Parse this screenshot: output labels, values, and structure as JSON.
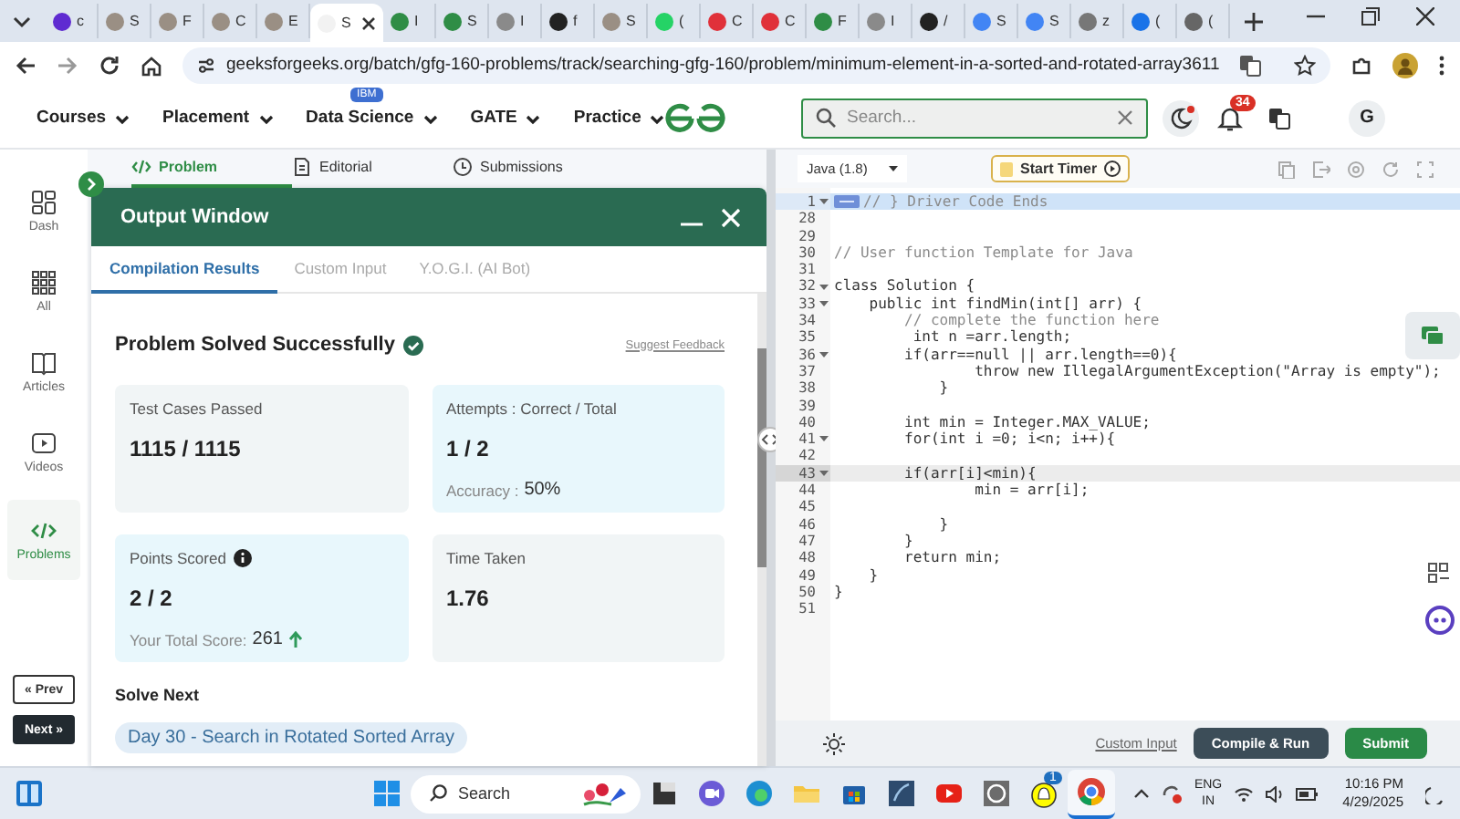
{
  "browser": {
    "tabs": [
      {
        "title": "c",
        "color": "#5f2bd1",
        "selected": false
      },
      {
        "title": "S",
        "color": "#9a8f84",
        "selected": false
      },
      {
        "title": "F",
        "color": "#9a8f84",
        "selected": false
      },
      {
        "title": "C",
        "color": "#9a8f84",
        "selected": false
      },
      {
        "title": "E",
        "color": "#9a8f84",
        "selected": false
      },
      {
        "title": "S",
        "color": "#f2f2f2",
        "selected": true
      },
      {
        "title": "I",
        "color": "#2f8d46",
        "selected": false
      },
      {
        "title": "S",
        "color": "#2f8d46",
        "selected": false
      },
      {
        "title": "I",
        "color": "#8a8a8a",
        "selected": false
      },
      {
        "title": "f",
        "color": "#222222",
        "selected": false
      },
      {
        "title": "S",
        "color": "#9a8f84",
        "selected": false
      },
      {
        "title": "(",
        "color": "#25d366",
        "selected": false
      },
      {
        "title": "C",
        "color": "#e0313a",
        "selected": false
      },
      {
        "title": "C",
        "color": "#e0313a",
        "selected": false
      },
      {
        "title": "F",
        "color": "#2f8d46",
        "selected": false
      },
      {
        "title": "I",
        "color": "#8a8a8a",
        "selected": false
      },
      {
        "title": "/",
        "color": "#222222",
        "selected": false
      },
      {
        "title": "S",
        "color": "#4285f4",
        "selected": false
      },
      {
        "title": "S",
        "color": "#4285f4",
        "selected": false
      },
      {
        "title": "z",
        "color": "#777777",
        "selected": false
      },
      {
        "title": "(",
        "color": "#1a73e8",
        "selected": false
      },
      {
        "title": "(",
        "color": "#666666",
        "selected": false
      }
    ],
    "url": "geeksforgeeks.org/batch/gfg-160-problems/track/searching-gfg-160/problem/minimum-element-in-a-sorted-and-rotated-array3611"
  },
  "site_nav": {
    "menus": [
      {
        "label": "Courses"
      },
      {
        "label": "Placement"
      },
      {
        "label": "Data Science",
        "badge": "IBM"
      },
      {
        "label": "GATE"
      },
      {
        "label": "Practice"
      }
    ],
    "search": {
      "placeholder": "Search..."
    },
    "notifications": "34",
    "avatar": "G"
  },
  "sidebar": {
    "items": [
      {
        "label": "Dash",
        "selected": false
      },
      {
        "label": "All",
        "selected": false
      },
      {
        "label": "Articles",
        "selected": false
      },
      {
        "label": "Videos",
        "selected": false
      },
      {
        "label": "Problems",
        "selected": true
      }
    ],
    "prev": "« Prev",
    "next": "Next »"
  },
  "problem_tabs": [
    {
      "label": "Problem",
      "selected": true
    },
    {
      "label": "Editorial",
      "selected": false
    },
    {
      "label": "Submissions",
      "selected": false
    }
  ],
  "output_window": {
    "title": "Output Window",
    "tabs": [
      {
        "label": "Compilation Results",
        "selected": true
      },
      {
        "label": "Custom Input",
        "selected": false
      },
      {
        "label": "Y.O.G.I. (AI Bot)",
        "selected": false
      }
    ],
    "status": "Problem Solved Successfully",
    "feedback_link": "Suggest Feedback",
    "cards": [
      {
        "label": "Test Cases Passed",
        "value": "1115 / 1115",
        "color": "#f1f5f6",
        "info": false
      },
      {
        "label": "Attempts : Correct / Total",
        "value": "1 / 2",
        "color": "#e8f7fc",
        "info": false,
        "footer": {
          "label": "Accuracy : ",
          "value": "50%"
        }
      },
      {
        "label": "Points Scored",
        "value": "2 / 2",
        "color": "#e8f7fc",
        "info": true,
        "footer": {
          "label": "Your Total Score: ",
          "value": "261",
          "rising": true
        }
      },
      {
        "label": "Time Taken",
        "value": "1.76",
        "color": "#f1f5f6",
        "info": false
      }
    ],
    "solve_next": {
      "heading": "Solve Next",
      "items": [
        "Day 30 - Search in Rotated Sorted Array"
      ]
    }
  },
  "editor": {
    "language": "Java (1.8)",
    "timer_button": "Start Timer",
    "lines": [
      {
        "number": "1",
        "kind": "folded",
        "text": "// } Driver Code Ends",
        "fold": true,
        "selected": true,
        "current": false
      },
      {
        "number": "28",
        "kind": "blank",
        "fold": false,
        "selected": false,
        "current": false
      },
      {
        "number": "29",
        "kind": "blank",
        "fold": false,
        "selected": false,
        "current": false
      },
      {
        "number": "30",
        "kind": "comment",
        "text": "// User function Template for Java",
        "fold": false,
        "selected": false,
        "current": false
      },
      {
        "number": "31",
        "kind": "blank",
        "fold": false,
        "selected": false,
        "current": false
      },
      {
        "number": "32",
        "kind": "code",
        "text": "class Solution {",
        "fold": true,
        "selected": false,
        "current": false
      },
      {
        "number": "33",
        "kind": "code",
        "text": "    public int findMin(int[] arr) {",
        "fold": true,
        "selected": false,
        "current": false
      },
      {
        "number": "34",
        "kind": "comment",
        "text": "        // complete the function here",
        "fold": false,
        "selected": false,
        "current": false
      },
      {
        "number": "35",
        "kind": "code",
        "text": "         int n =arr.length;",
        "fold": false,
        "selected": false,
        "current": false
      },
      {
        "number": "36",
        "kind": "code",
        "text": "        if(arr==null || arr.length==0){",
        "fold": true,
        "selected": false,
        "current": false
      },
      {
        "number": "37",
        "kind": "code",
        "text": "                throw new IllegalArgumentException(\"Array is empty\");",
        "fold": false,
        "selected": false,
        "current": false
      },
      {
        "number": "38",
        "kind": "code",
        "text": "            }",
        "fold": false,
        "selected": false,
        "current": false
      },
      {
        "number": "39",
        "kind": "blank",
        "fold": false,
        "selected": false,
        "current": false
      },
      {
        "number": "40",
        "kind": "code",
        "text": "        int min = Integer.MAX_VALUE;",
        "fold": false,
        "selected": false,
        "current": false
      },
      {
        "number": "41",
        "kind": "code",
        "text": "        for(int i =0; i<n; i++){",
        "fold": true,
        "selected": false,
        "current": false
      },
      {
        "number": "42",
        "kind": "blank",
        "fold": false,
        "selected": false,
        "current": false
      },
      {
        "number": "43",
        "kind": "code",
        "text": "        if(arr[i]<min){",
        "fold": true,
        "selected": false,
        "current": true
      },
      {
        "number": "44",
        "kind": "code",
        "text": "                min = arr[i];",
        "fold": false,
        "selected": false,
        "current": false
      },
      {
        "number": "45",
        "kind": "blank",
        "fold": false,
        "selected": false,
        "current": false
      },
      {
        "number": "46",
        "kind": "code",
        "text": "            }",
        "fold": false,
        "selected": false,
        "current": false
      },
      {
        "number": "47",
        "kind": "code",
        "text": "        }",
        "fold": false,
        "selected": false,
        "current": false
      },
      {
        "number": "48",
        "kind": "code",
        "text": "        return min;",
        "fold": false,
        "selected": false,
        "current": false
      },
      {
        "number": "49",
        "kind": "code",
        "text": "    }",
        "fold": false,
        "selected": false,
        "current": false
      },
      {
        "number": "50",
        "kind": "code",
        "text": "}",
        "fold": false,
        "selected": false,
        "current": false
      },
      {
        "number": "51",
        "kind": "blank",
        "fold": false,
        "selected": false,
        "current": false
      }
    ],
    "custom_input_link": "Custom Input",
    "compile_button": "Compile & Run",
    "submit_button": "Submit"
  },
  "taskbar": {
    "search": {
      "placeholder": "Search"
    },
    "apps": [
      {
        "selected": false
      },
      {
        "selected": false
      },
      {
        "selected": false
      },
      {
        "selected": false
      },
      {
        "selected": false
      },
      {
        "selected": false
      },
      {
        "selected": false
      },
      {
        "selected": false
      },
      {
        "selected": false,
        "badge": "1"
      },
      {
        "selected": true
      }
    ],
    "language": "ENG",
    "region": "IN",
    "time": "10:16 PM",
    "date": "4/29/2025"
  }
}
